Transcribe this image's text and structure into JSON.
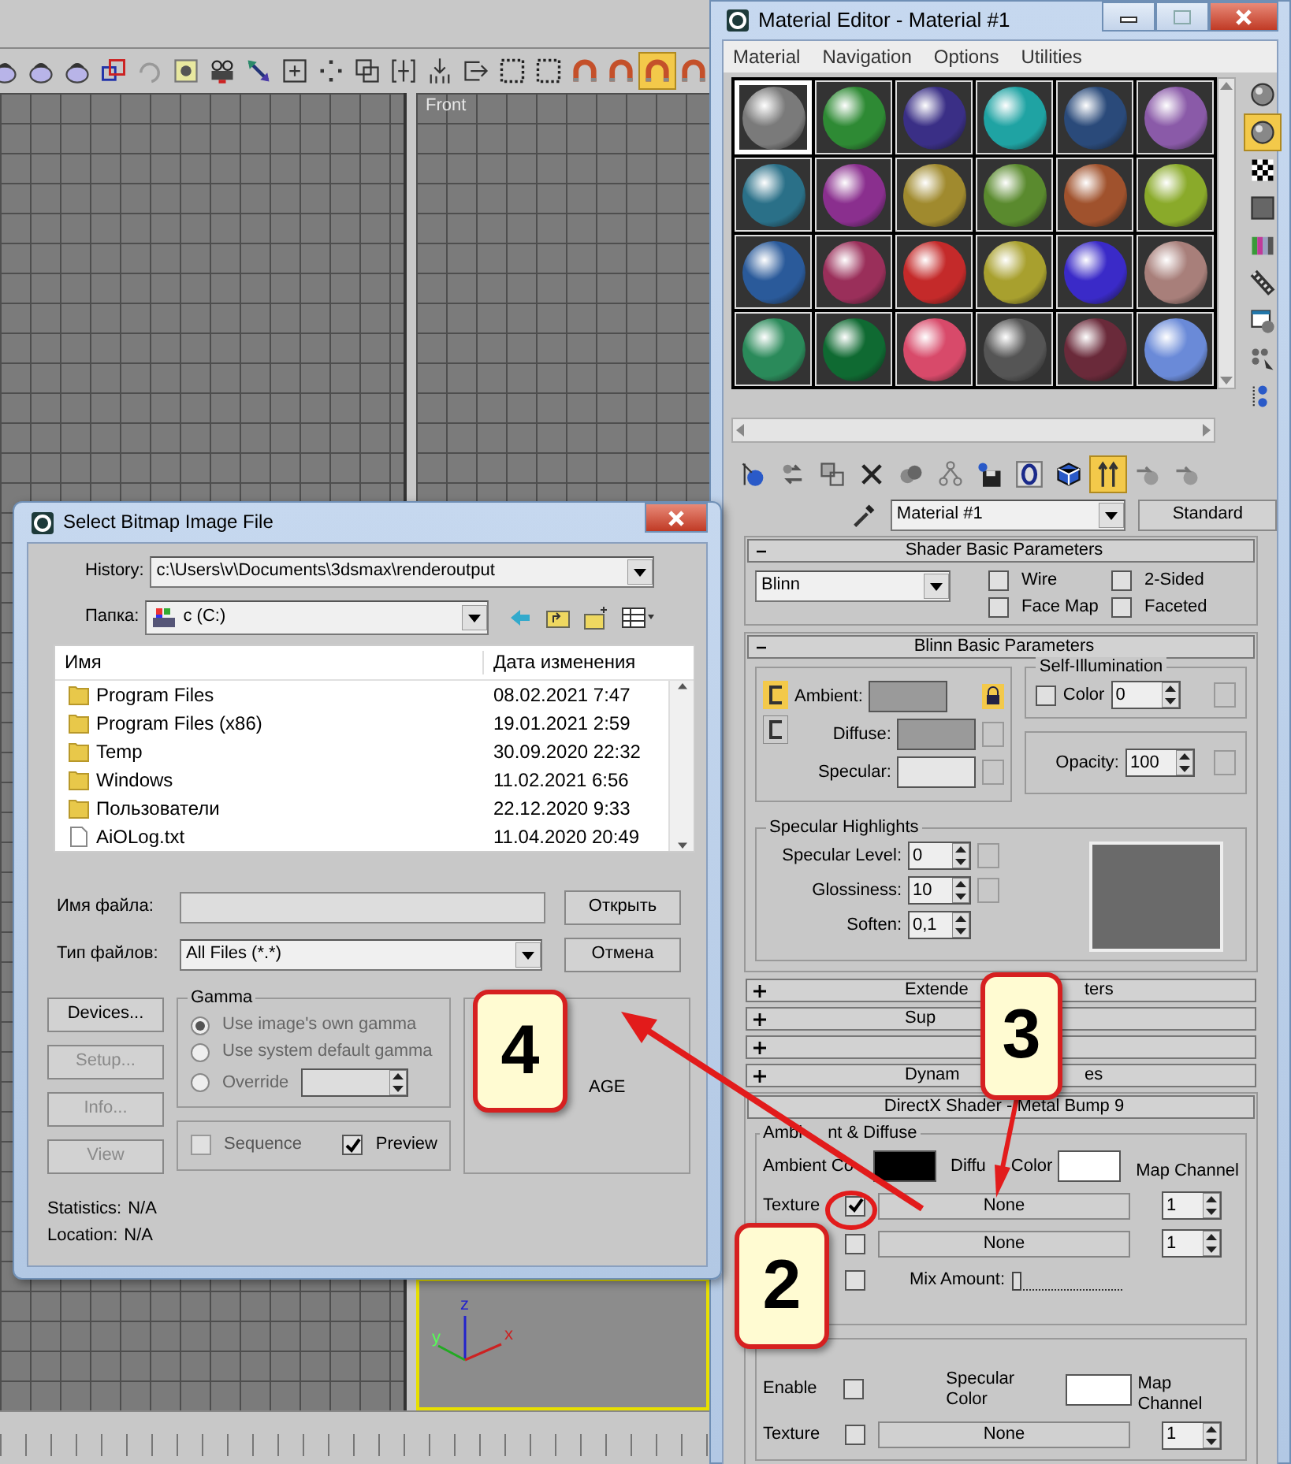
{
  "main_toolbar": [
    {
      "active": false
    },
    {
      "active": false
    },
    {
      "active": false
    },
    {
      "active": false
    },
    {
      "active": false
    },
    {
      "active": false
    },
    {
      "active": false
    },
    {
      "active": false
    },
    {
      "active": false
    },
    {
      "active": false
    },
    {
      "active": false
    },
    {
      "active": false
    },
    {
      "active": false
    },
    {
      "active": false
    },
    {
      "active": false
    },
    {
      "active": false
    },
    {
      "active": false
    },
    {
      "active": false
    },
    {
      "active": true
    },
    {
      "active": false
    }
  ],
  "viewports": [
    {
      "label": "Front"
    }
  ],
  "axis_gizmo": {
    "labels": [
      "z",
      "y",
      "x"
    ]
  },
  "material_editor": {
    "title": "Material Editor - Material #1",
    "menu": [
      "Material",
      "Navigation",
      "Options",
      "Utilities"
    ],
    "slots": [
      {
        "color": "#7a7a7a",
        "selected": true
      },
      {
        "color": "#2e8a34",
        "selected": false
      },
      {
        "color": "#3a2f86",
        "selected": false
      },
      {
        "color": "#1fa3a3",
        "selected": false
      },
      {
        "color": "#2a4a7a",
        "selected": false
      },
      {
        "color": "#8a5aa8",
        "selected": false
      },
      {
        "color": "#2a7088",
        "selected": false
      },
      {
        "color": "#8a2f8e",
        "selected": false
      },
      {
        "color": "#a08a2e",
        "selected": false
      },
      {
        "color": "#5a8a2e",
        "selected": false
      },
      {
        "color": "#a0522d",
        "selected": false
      },
      {
        "color": "#8aaa2a",
        "selected": false
      },
      {
        "color": "#2a5a9a",
        "selected": false
      },
      {
        "color": "#9a2f5a",
        "selected": false
      },
      {
        "color": "#c42a2a",
        "selected": false
      },
      {
        "color": "#a8a02e",
        "selected": false
      },
      {
        "color": "#3a2ac8",
        "selected": false
      },
      {
        "color": "#a87f7a",
        "selected": false
      },
      {
        "color": "#2a8a5a",
        "selected": false
      },
      {
        "color": "#0f6a32",
        "selected": false
      },
      {
        "color": "#d84a6a",
        "selected": false
      },
      {
        "color": "#555555",
        "selected": false
      },
      {
        "color": "#6a2a3a",
        "selected": false
      },
      {
        "color": "#6a8ad8",
        "selected": false
      }
    ],
    "side_tools": [
      {
        "active": false
      },
      {
        "active": true
      },
      {
        "active": false
      },
      {
        "active": false
      },
      {
        "active": false
      },
      {
        "active": false
      },
      {
        "active": false
      },
      {
        "active": false
      },
      {
        "active": false
      }
    ],
    "bottom_tools": [
      {
        "active": false
      },
      {
        "active": false
      },
      {
        "active": false
      },
      {
        "active": false
      },
      {
        "active": false
      },
      {
        "active": false
      },
      {
        "active": false
      },
      {
        "active": false
      },
      {
        "active": false
      },
      {
        "active": true
      },
      {
        "active": false
      },
      {
        "active": false
      }
    ],
    "material_name": "Material #1",
    "type_button": "Standard",
    "shader_basic": {
      "title": "Shader Basic Parameters",
      "expanded": true,
      "shader": "Blinn",
      "options": [
        {
          "label": "Wire",
          "checked": false
        },
        {
          "label": "2-Sided",
          "checked": false
        },
        {
          "label": "Face Map",
          "checked": false
        },
        {
          "label": "Faceted",
          "checked": false
        }
      ]
    },
    "blinn_basic": {
      "title": "Blinn Basic Parameters",
      "expanded": true,
      "colors": [
        {
          "label": "Ambient:",
          "color": "#9a9a9a"
        },
        {
          "label": "Diffuse:",
          "color": "#9a9a9a"
        },
        {
          "label": "Specular:",
          "color": "#e6e6e6"
        }
      ],
      "self_illumination": {
        "title": "Self-Illumination",
        "label": "Color",
        "checked": false,
        "value": "0"
      },
      "opacity": {
        "label": "Opacity:",
        "value": "100"
      },
      "specular_highlights": {
        "title": "Specular Highlights",
        "fields": [
          {
            "label": "Specular Level:",
            "value": "0"
          },
          {
            "label": "Glossiness:",
            "value": "10"
          },
          {
            "label": "Soften:",
            "value": "0,1"
          }
        ]
      }
    },
    "collapsed_rollouts": [
      {
        "expanded": false,
        "visible_parts": [
          "Extende",
          "ters"
        ]
      },
      {
        "expanded": false,
        "visible_parts": [
          "Sup"
        ]
      },
      {
        "expanded": false
      },
      {
        "expanded": false,
        "visible_parts": [
          "Dynam",
          "es"
        ]
      }
    ],
    "directx": {
      "title": "DirectX Shader - Metal Bump 9",
      "ambient_diffuse": {
        "title_parts": [
          "Ambi",
          "nt & Diffuse"
        ],
        "ambient_label": "Ambient Co",
        "diffuse_label_parts": [
          "Diffu",
          "Color"
        ],
        "map_channel_label": "Map Channel",
        "textures": [
          {
            "label": "Texture",
            "checked": true,
            "map": "None",
            "channel": "1"
          },
          {
            "checked": false,
            "map": "None",
            "channel": "1"
          }
        ],
        "mix": {
          "checked": false,
          "label": "Mix Amount:",
          "level": 0.0
        }
      },
      "specular": {
        "enable_label": "Enable",
        "enable_checked": false,
        "color_label": "Specular Color",
        "map_channel_label": "Map Channel",
        "texture_label": "Texture",
        "texture_checked": false,
        "map": "None",
        "channel": "1"
      }
    }
  },
  "dialog": {
    "title": "Select Bitmap Image File",
    "history_label": "History:",
    "history": "c:\\Users\\v\\Documents\\3dsmax\\renderoutput",
    "folder_label": "Папка:",
    "folder": "c (C:)",
    "columns": [
      "Имя",
      "Дата изменения"
    ],
    "files": [
      {
        "kind": "folder",
        "name": "Program Files",
        "date": "08.02.2021 7:47"
      },
      {
        "kind": "folder",
        "name": "Program Files (x86)",
        "date": "19.01.2021 2:59"
      },
      {
        "kind": "folder",
        "name": "Temp",
        "date": "30.09.2020 22:32"
      },
      {
        "kind": "folder",
        "name": "Windows",
        "date": "11.02.2021 6:56"
      },
      {
        "kind": "folder",
        "name": "Пользователи",
        "date": "22.12.2020 9:33"
      },
      {
        "kind": "file",
        "name": "AiOLog.txt",
        "date": "11.04.2020 20:49"
      }
    ],
    "filename_label": "Имя файла:",
    "filetype_label": "Тип файлов:",
    "filetype": "All Files (*.*)",
    "open_button": "Открыть",
    "cancel_button": "Отмена",
    "side_buttons": [
      {
        "label": "Devices...",
        "disabled": false
      },
      {
        "label": "Setup...",
        "disabled": true
      },
      {
        "label": "Info...",
        "disabled": true
      },
      {
        "label": "View",
        "disabled": true
      }
    ],
    "gamma": {
      "title": "Gamma",
      "options": [
        {
          "label": "Use image's own gamma",
          "selected": true
        },
        {
          "label": "Use system default gamma",
          "selected": false
        },
        {
          "label": "Override",
          "selected": false
        }
      ]
    },
    "sequence": {
      "label": "Sequence",
      "checked": false
    },
    "preview": {
      "label": "Preview",
      "checked": true
    },
    "preview_text": "AGE",
    "statistics": {
      "label": "Statistics:",
      "value": "N/A"
    },
    "location": {
      "label": "Location:",
      "value": "N/A"
    }
  },
  "callouts": [
    {
      "number": "2"
    },
    {
      "number": "3"
    },
    {
      "number": "4"
    }
  ]
}
